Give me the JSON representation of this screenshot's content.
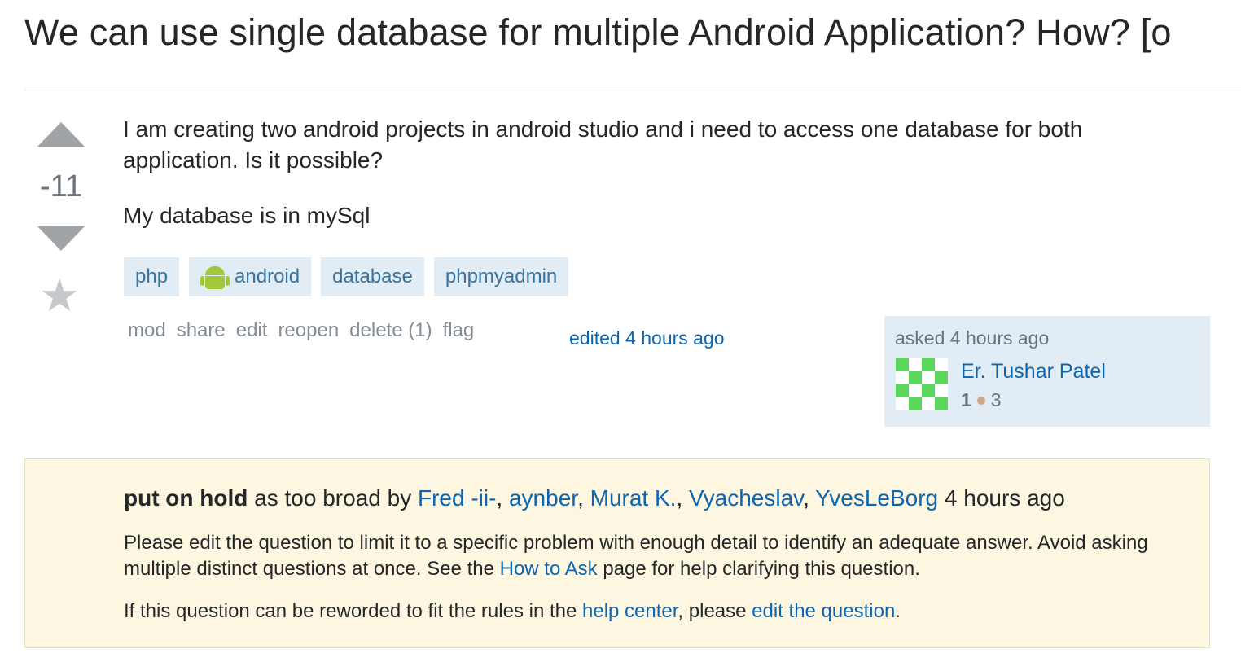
{
  "question": {
    "title": "We can use single database for multiple Android Application? How? [o",
    "score": "-11",
    "body": [
      "I am creating two android projects in android studio and i need to access one database for both application. Is it possible?",
      "My database is in mySql"
    ],
    "tags": [
      "php",
      "android",
      "database",
      "phpmyadmin"
    ],
    "tag_icon": "android-icon"
  },
  "actions": [
    "mod",
    "share",
    "edit",
    "reopen",
    "delete (1)",
    "flag"
  ],
  "edited": "edited 4 hours ago",
  "owner": {
    "asked": "asked 4 hours ago",
    "name": "Er. Tushar Patel",
    "reputation": "1",
    "bronze": "3",
    "bronze_color": "#d1a684"
  },
  "hold": {
    "status": "put on hold",
    "reason": " as too broad by ",
    "voters": [
      "Fred -ii-",
      "aynber",
      "Murat K.",
      "Vyacheslav",
      "YvesLeBorg"
    ],
    "sep": ", ",
    "time": " 4 hours ago",
    "p1_start": "Please edit the question to limit it to a specific problem with enough detail to identify an adequate answer. Avoid asking multiple distinct questions at once. See the ",
    "p1_link": "How to Ask",
    "p1_end": " page for help clarifying this question.",
    "p2_start": "If this question can be reworded to fit the rules in the ",
    "p2_link1": "help center",
    "p2_mid": ", please ",
    "p2_link2": "edit the question",
    "p2_end": "."
  },
  "colors": {
    "link": "#0c65b0",
    "tag_bg": "#e1ecf4",
    "tag_text": "#39739d",
    "hold_bg": "#fdf7e2",
    "avatar_green": "#5bd85b"
  }
}
